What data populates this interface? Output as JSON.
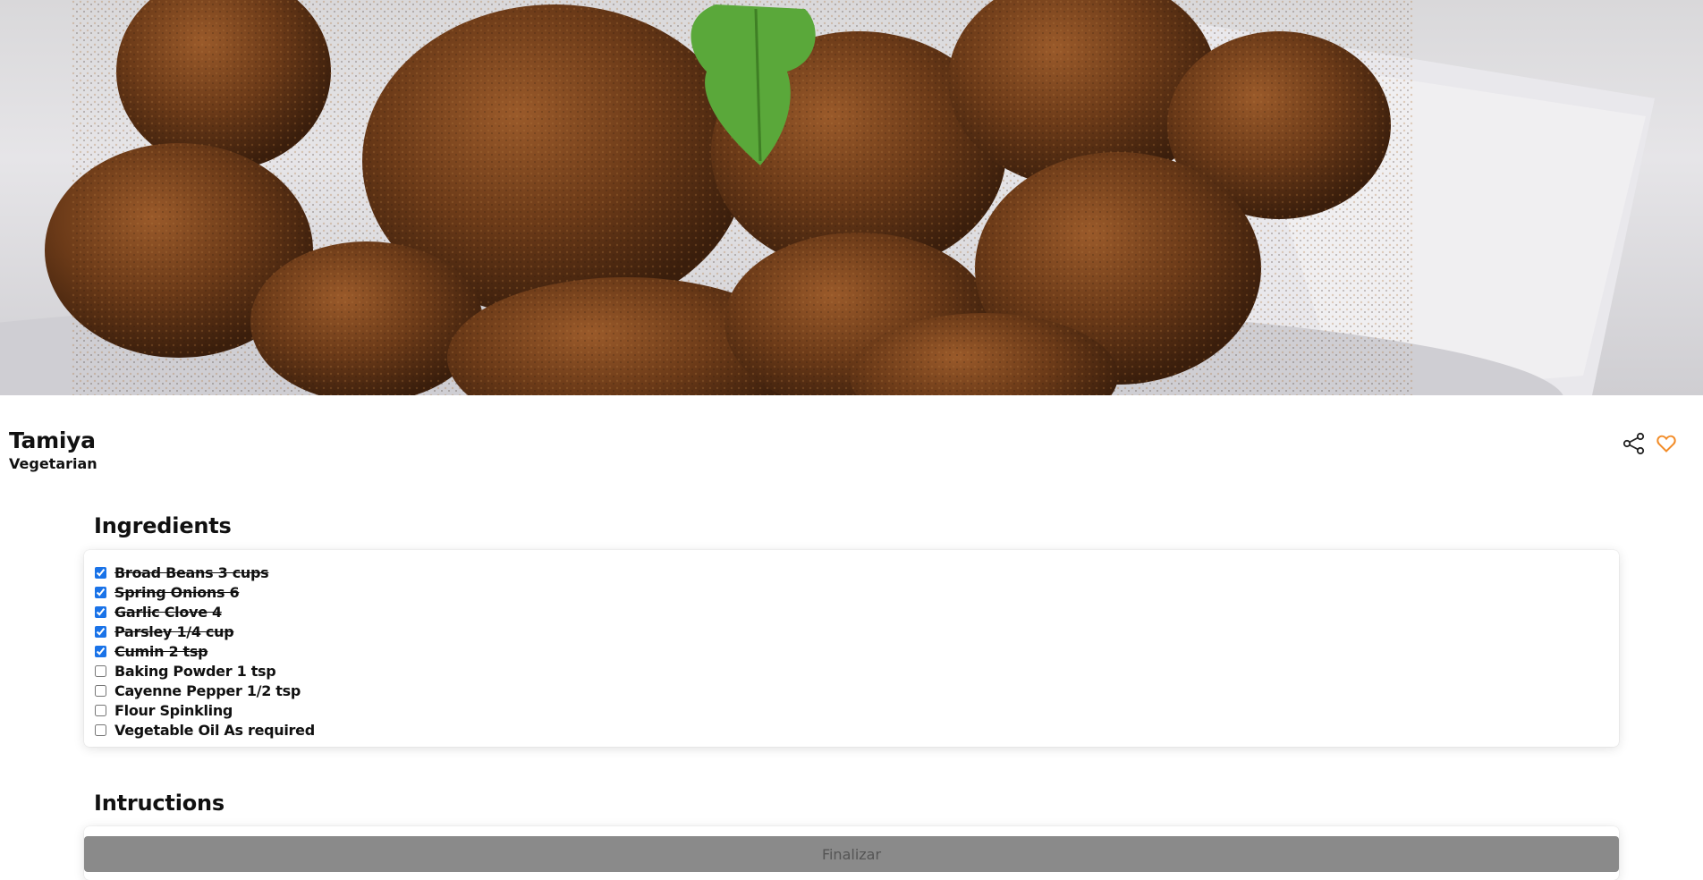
{
  "recipe": {
    "title": "Tamiya",
    "category": "Vegetarian"
  },
  "actions": {
    "share_icon": "share-icon",
    "favorite_icon": "heart-outline-icon",
    "favorite_color": "#f28c28"
  },
  "ingredients": {
    "heading": "Ingredients",
    "items": [
      {
        "label": "Broad Beans 3 cups",
        "checked": true
      },
      {
        "label": "Spring Onions 6",
        "checked": true
      },
      {
        "label": "Garlic Clove 4",
        "checked": true
      },
      {
        "label": "Parsley 1/4 cup",
        "checked": true
      },
      {
        "label": "Cumin 2 tsp",
        "checked": true
      },
      {
        "label": "Baking Powder 1 tsp",
        "checked": false
      },
      {
        "label": "Cayenne Pepper 1/2 tsp",
        "checked": false
      },
      {
        "label": "Flour Spinkling",
        "checked": false
      },
      {
        "label": "Vegetable Oil As required",
        "checked": false
      }
    ]
  },
  "instructions": {
    "heading": "Intructions"
  },
  "finish_button": {
    "label": "Finalizar",
    "background": "#8a8a8a"
  }
}
